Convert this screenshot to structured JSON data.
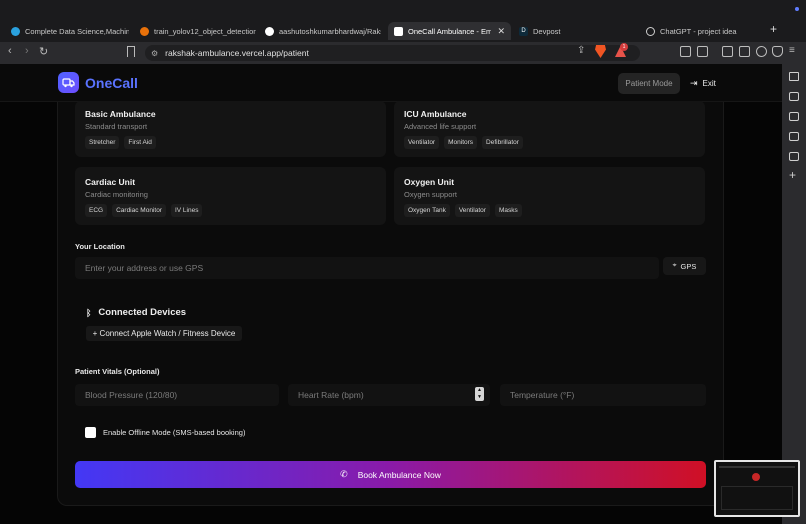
{
  "browser": {
    "tabs": [
      {
        "title": "Complete Data Science,Machine",
        "icon": "telegram-icon",
        "color": "#2aa1de"
      },
      {
        "title": "train_yolov12_object_detection",
        "icon": "colab-icon",
        "color": "#e8710a"
      },
      {
        "title": "aashutoshkumarbhardwaj/Raksh",
        "icon": "github-icon",
        "color": "#ffffff"
      },
      {
        "title": "OneCall Ambulance - Emerg",
        "icon": "vercel-icon",
        "color": "#ffffff"
      },
      {
        "title": "Devpost",
        "icon": "devpost-icon",
        "color": "#003e54"
      },
      {
        "title": "ChatGPT - project idea",
        "icon": "chatgpt-icon",
        "color": "#d9d9d9"
      }
    ],
    "url": "rakshak-ambulance.vercel.app/patient",
    "notification_count": "1"
  },
  "header": {
    "brand": "OneCall",
    "mode_label": "Patient Mode",
    "exit_label": "Exit",
    "accent": "#5a73ff"
  },
  "ambulances": [
    {
      "name": "Basic Ambulance",
      "desc": "Standard transport",
      "tags": [
        "Stretcher",
        "First Aid"
      ]
    },
    {
      "name": "ICU Ambulance",
      "desc": "Advanced life support",
      "tags": [
        "Ventilator",
        "Monitors",
        "Defibrillator"
      ]
    },
    {
      "name": "Cardiac Unit",
      "desc": "Cardiac monitoring",
      "tags": [
        "ECG",
        "Cardiac Monitor",
        "IV Lines"
      ]
    },
    {
      "name": "Oxygen Unit",
      "desc": "Oxygen support",
      "tags": [
        "Oxygen Tank",
        "Ventilator",
        "Masks"
      ]
    }
  ],
  "location": {
    "label": "Your Location",
    "placeholder": "Enter your address or use GPS",
    "gps_label": "GPS"
  },
  "devices": {
    "title": "Connected Devices",
    "connect_label": "+ Connect Apple Watch / Fitness Device"
  },
  "vitals": {
    "label": "Patient Vitals (Optional)",
    "bp_placeholder": "Blood Pressure (120/80)",
    "hr_placeholder": "Heart Rate (bpm)",
    "temp_placeholder": "Temperature (°F)"
  },
  "offline": {
    "label": "Enable Offline Mode (SMS-based booking)",
    "checked": false
  },
  "book": {
    "label": "Book Ambulance Now",
    "gradient": [
      "#4338f5",
      "#8a1aa8",
      "#d01025"
    ]
  }
}
